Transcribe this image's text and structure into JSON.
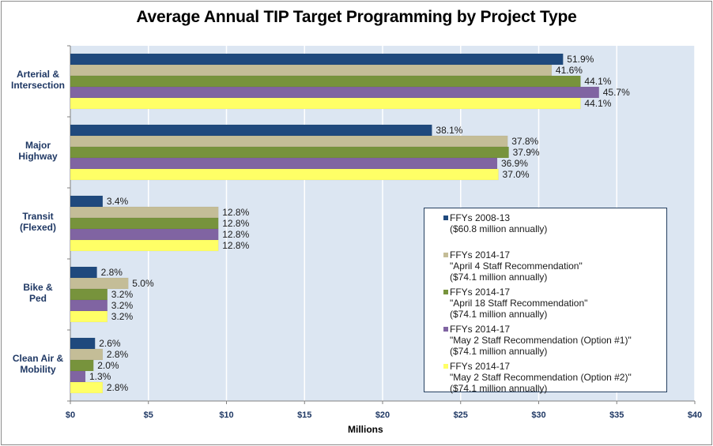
{
  "chart_data": {
    "type": "bar",
    "orientation": "horizontal",
    "title": "Average Annual TIP Target Programming by Project Type",
    "xlabel": "Millions",
    "ylabel": "",
    "xlim": [
      0,
      40
    ],
    "x_ticks": [
      "$0",
      "$5",
      "$10",
      "$15",
      "$20",
      "$25",
      "$30",
      "$35",
      "$40"
    ],
    "x_tick_values": [
      0,
      5,
      10,
      15,
      20,
      25,
      30,
      35,
      40
    ],
    "grid": true,
    "legend_position": "bottom-right inside",
    "categories": [
      "Arterial & Intersection",
      "Major Highway",
      "Transit (Flexed)",
      "Bike & Ped",
      "Clean Air & Mobility"
    ],
    "category_label_lines": [
      [
        "Arterial &",
        "Intersection"
      ],
      [
        "Major",
        "Highway"
      ],
      [
        "Transit",
        "(Flexed)"
      ],
      [
        "Bike &",
        "Ped"
      ],
      [
        "Clean Air &",
        "Mobility"
      ]
    ],
    "series": [
      {
        "name": "FFYs 2008-13 ($60.8 million annually)",
        "legend_lines": [
          "FFYs 2008-13",
          "($60.8 million annually)"
        ],
        "color": "#1f497d",
        "values": [
          31.56,
          23.16,
          2.07,
          1.7,
          1.58
        ],
        "labels": [
          "51.9%",
          "38.1%",
          "3.4%",
          "2.8%",
          "2.6%"
        ]
      },
      {
        "name": "FFYs 2014-17 \"April 4 Staff Recommendation\" ($74.1 million annually)",
        "legend_lines": [
          "FFYs 2014-17",
          "\"April 4 Staff Recommendation\"",
          "($74.1 million annually)"
        ],
        "color": "#c4bd97",
        "values": [
          30.83,
          28.01,
          9.48,
          3.71,
          2.07
        ],
        "labels": [
          "41.6%",
          "37.8%",
          "12.8%",
          "5.0%",
          "2.8%"
        ]
      },
      {
        "name": "FFYs 2014-17 \"April 18 Staff Recommendation\" ($74.1 million annually)",
        "legend_lines": [
          "FFYs 2014-17",
          "\"April 18 Staff Recommendation\"",
          "($74.1 million annually)"
        ],
        "color": "#77933c",
        "values": [
          32.68,
          28.08,
          9.48,
          2.37,
          1.48
        ],
        "labels": [
          "44.1%",
          "37.9%",
          "12.8%",
          "3.2%",
          "2.0%"
        ]
      },
      {
        "name": "FFYs 2014-17 \"May 2 Staff Recommendation (Option #1)\" ($74.1 million annually)",
        "legend_lines": [
          "FFYs 2014-17",
          "\"May 2 Staff Recommendation (Option #1)\"",
          "($74.1 million annually)"
        ],
        "color": "#8064a2",
        "values": [
          33.86,
          27.34,
          9.48,
          2.37,
          0.96
        ],
        "labels": [
          "45.7%",
          "36.9%",
          "12.8%",
          "3.2%",
          "1.3%"
        ]
      },
      {
        "name": "FFYs 2014-17 \"May 2 Staff Recommendation (Option #2)\" ($74.1 million annually)",
        "legend_lines": [
          "FFYs 2014-17",
          "\"May 2 Staff Recommendation (Option #2)\"",
          "($74.1 million annually)"
        ],
        "color": "#ffff66",
        "values": [
          32.68,
          27.42,
          9.48,
          2.37,
          2.07
        ],
        "labels": [
          "44.1%",
          "37.0%",
          "12.8%",
          "3.2%",
          "2.8%"
        ]
      }
    ]
  }
}
